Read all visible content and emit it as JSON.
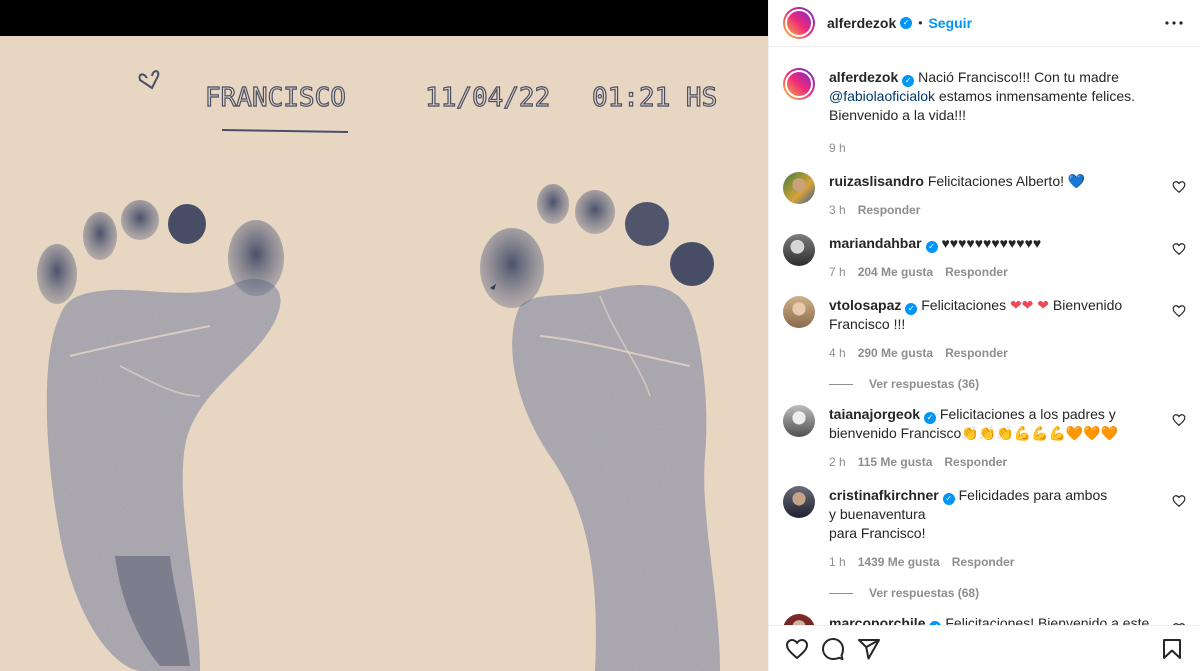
{
  "post": {
    "owner": "alferdezok",
    "dot": "•",
    "follow_label": "Seguir",
    "photo_text": {
      "name": "FRANCISCO",
      "date": "11/04/22",
      "time": "01:21 HS"
    }
  },
  "caption": {
    "username": "alferdezok",
    "text_start": "Nació Francisco!!! Con tu madre ",
    "mention": "@fabiolaoficialok",
    "text_end": " estamos inmensamente felices. Bienvenido a la vida!!!",
    "time": "9 h"
  },
  "comments": [
    {
      "username": "ruizaslisandro",
      "verified": false,
      "text": "Felicitaciones Alberto! ",
      "emoji": "💙",
      "time": "3 h",
      "likes": "",
      "reply": "Responder"
    },
    {
      "username": "mariandahbar",
      "verified": true,
      "text": "",
      "emoji": "♥♥♥♥♥♥♥♥♥♥♥♥",
      "time": "7 h",
      "likes": "204 Me gusta",
      "reply": "Responder"
    },
    {
      "username": "vtolosapaz",
      "verified": true,
      "text": "Felicitaciones ",
      "emoji": "❤❤ ❤",
      "text2": " Bienvenido Francisco !!!",
      "time": "4 h",
      "likes": "290 Me gusta",
      "reply": "Responder",
      "replies": "Ver respuestas (36)"
    },
    {
      "username": "taianajorgeok",
      "verified": true,
      "text": "Felicitaciones a los padres y bienvenido Francisco",
      "emoji": "👏👏👏💪💪💪🧡🧡🧡",
      "time": "2 h",
      "likes": "115 Me gusta",
      "reply": "Responder"
    },
    {
      "username": "cristinafkirchner",
      "verified": true,
      "text": "Felicidades para ambos\ny buenaventura\npara Francisco!",
      "emoji": "",
      "time": "1 h",
      "likes": "1439 Me gusta",
      "reply": "Responder",
      "replies": "Ver respuestas (68)"
    },
    {
      "username": "marcoporchile",
      "verified": true,
      "text": "Felicitaciones! Bienvenido a este mundo al gran Francisco. En Chile tendrá una subsede para su",
      "emoji": "",
      "time": "",
      "likes": "",
      "reply": ""
    }
  ],
  "icons": {
    "more": "more-options-icon",
    "like": "heart-icon",
    "comment": "comment-icon",
    "share": "share-icon",
    "save": "bookmark-icon",
    "verified": "verified-badge-icon"
  },
  "colors": {
    "link": "#0095f6",
    "mention": "#00376b",
    "muted": "#8e8e8e",
    "photo_bg": "#ecdcca",
    "ink": "#3f4a6a"
  }
}
